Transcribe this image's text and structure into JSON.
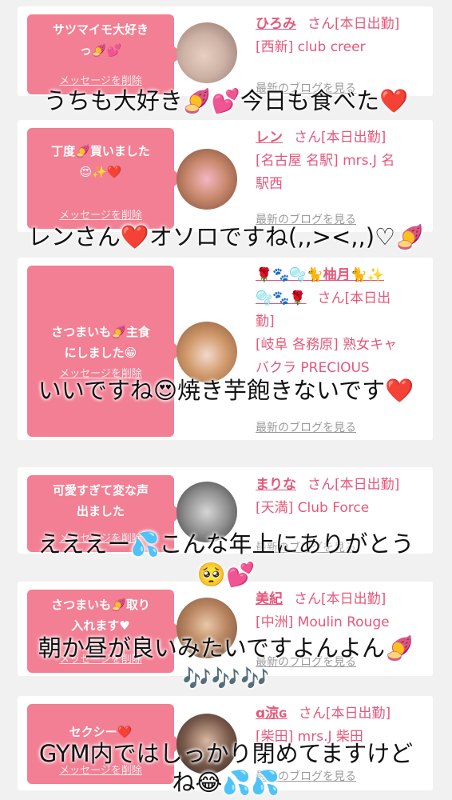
{
  "cards": [
    {
      "bubble_lines": [
        "サツマイモ大好き",
        "っ🍠💕"
      ],
      "delete_label": "メッセージを削除",
      "name": "ひろみ",
      "status": "さん[本日出勤]",
      "shop_lines": [
        "[西新] club creer"
      ],
      "blog_label": "最新のブログを見る"
    },
    {
      "bubble_lines": [
        "丁度🍠買いました",
        "😍✨❤️"
      ],
      "delete_label": "メッセージを削除",
      "name": "レン",
      "status": "さん[本日出勤]",
      "shop_lines": [
        "[名古屋 名駅] mrs.J 名",
        "駅西"
      ],
      "blog_label": "最新のブログを見る"
    },
    {
      "bubble_lines": [
        "さつまいも🍠主食",
        "にしました😁"
      ],
      "delete_label": "メッセージを削除",
      "name": "🌹🐾🫧🐈柚月🐈✨",
      "name_line2": "🫧🐾🌹",
      "status": "さん[本日出",
      "status2": "勤]",
      "shop_lines": [
        "[岐阜 各務原]  熟女キャ",
        "バクラ PRECIOUS"
      ],
      "blog_label": "最新のブログを見る"
    },
    {
      "bubble_lines": [
        "可愛すぎて変な声",
        "出ました"
      ],
      "delete_label": "メッセージを削除",
      "name": "まりな",
      "status": "さん[本日出勤]",
      "shop_lines": [
        "[天満] Club Force"
      ],
      "blog_label": "最新のブログを見る"
    },
    {
      "bubble_lines": [
        "さつまいも🍠取り",
        "入れます♥"
      ],
      "delete_label": "メッセージを削除",
      "name": "美紀",
      "status": "さん[本日出勤]",
      "shop_lines": [
        "[中洲] Moulin Rouge"
      ],
      "blog_label": "最新のブログを見る"
    },
    {
      "bubble_lines": [
        "セクシー❤️"
      ],
      "delete_label": "メッセージを削除",
      "name": "ɑ涼ɢ",
      "status": "さん[本日出勤]",
      "shop_lines": [
        "[柴田] mrs.J 柴田"
      ],
      "blog_label": "最新のブログを見る"
    }
  ],
  "overlays": [
    "うちも大好き🍠💕今日も食べた❤️",
    "レンさん❤️オソロですね(,,><,,)♡🍠",
    "いいですね😍焼き芋飽きないです❤️",
    "えええー💦こんな年上にありがとう",
    "🥺💕",
    "朝か昼が良いみたいですよんよん🍠",
    "🎶🎶🎶",
    "GYM内ではしっかり閉めてますけど",
    "ね😂💦💦"
  ],
  "colors": {
    "bubble": "#f27f93",
    "accent": "#e4587a",
    "background": "#f1f1f1"
  }
}
